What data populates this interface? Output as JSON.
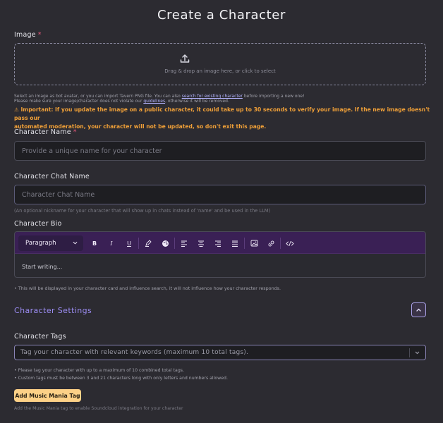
{
  "title": "Create a Character",
  "image": {
    "label": "Image",
    "required_mark": "*",
    "dropzone_text": "Drag & drop an image here, or click to select",
    "upload_icon": "upload-icon"
  },
  "notes": {
    "line1_pre": "Select an image as bot avatar, or you can import Tavern PNG file. You can also ",
    "line1_link": "search for existing character",
    "line1_post": " before importing a new one!",
    "line2_pre": "Please make sure your image/character does not violate our ",
    "line2_link": "guidelines",
    "line2_post": ", otherwise it will be removed.",
    "warning_line1": "⚠ Important: If you update the image on a public character, it could take up to 30 seconds to verify your image. If the new image doesn't pass our",
    "warning_line2": "automated moderation, your character will not be updated, so don't exit this page."
  },
  "character_name": {
    "label": "Character Name",
    "required_mark": "*",
    "placeholder": "Provide a unique name for your character"
  },
  "chat_name": {
    "label": "Character Chat Name",
    "placeholder": "Character Chat Name",
    "hint": "(An optional nickname for your character that will show up in chats instead of 'name' and be used in the LLM)"
  },
  "bio": {
    "label": "Character Bio",
    "format_select": "Paragraph",
    "bold": "B",
    "italic": "I",
    "underline": "U",
    "placeholder": "Start writing...",
    "hint": "This will be displayed in your character card and influence search, it will not influence how your character responds."
  },
  "settings": {
    "section_title": "Character Settings"
  },
  "tags": {
    "label": "Character Tags",
    "placeholder": "Tag your character with relevant keywords (maximum 10 total tags).",
    "hint1": "Please tag your character with up to a maximum of 10 combined total tags.",
    "hint2": "Custom tags must be between 3 and 21 characters long with only letters and numbers allowed."
  },
  "music": {
    "button_label": "Add Music Mania Tag",
    "hint": "Add the Music Mania tag to enable Soundcloud integration for your character"
  },
  "colors": {
    "background": "#2c2b31",
    "accent": "#9b8cf2",
    "warning": "#f0a038",
    "music_button": "#fdd187",
    "toolbar": "#3a2055"
  }
}
